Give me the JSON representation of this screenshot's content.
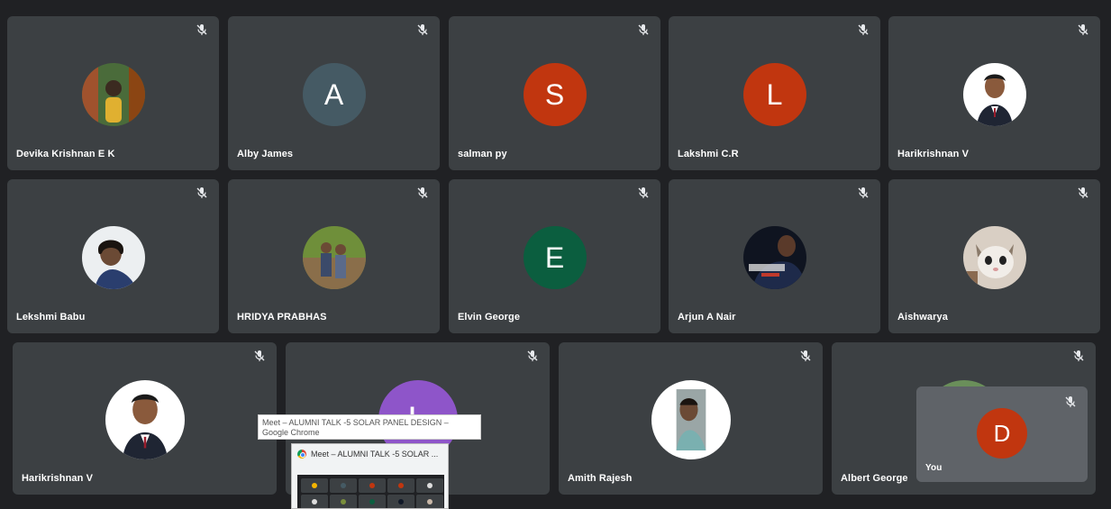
{
  "participants": [
    {
      "name": "Devika Krishnan E K",
      "initial": "",
      "avatar": "photo",
      "color": "#6b8e4e"
    },
    {
      "name": "Alby James",
      "initial": "A",
      "avatar": "letter",
      "color": "#455a64"
    },
    {
      "name": "salman py",
      "initial": "S",
      "avatar": "letter",
      "color": "#c1360f"
    },
    {
      "name": "Lakshmi C.R",
      "initial": "L",
      "avatar": "letter",
      "color": "#c1360f"
    },
    {
      "name": "Harikrishnan V",
      "initial": "",
      "avatar": "photo",
      "color": "#ffffff"
    },
    {
      "name": "Lekshmi Babu",
      "initial": "",
      "avatar": "photo",
      "color": "#e8e8e8"
    },
    {
      "name": "HRIDYA PRABHAS",
      "initial": "",
      "avatar": "photo",
      "color": "#7a8f3c"
    },
    {
      "name": "Elvin George",
      "initial": "E",
      "avatar": "letter",
      "color": "#0b5e3f"
    },
    {
      "name": "Arjun A Nair",
      "initial": "",
      "avatar": "photo",
      "color": "#101827"
    },
    {
      "name": "Aishwarya",
      "initial": "",
      "avatar": "photo",
      "color": "#c9b8a8"
    },
    {
      "name": "Harikrishnan V",
      "initial": "",
      "avatar": "photo",
      "color": "#ffffff"
    },
    {
      "name": "",
      "initial": "L",
      "avatar": "letter",
      "color": "#8e55c9"
    },
    {
      "name": "Amith Rajesh",
      "initial": "",
      "avatar": "photo",
      "color": "#ffffff"
    },
    {
      "name": "Albert George",
      "initial": "",
      "avatar": "photo",
      "color": "#6a8f5a"
    }
  ],
  "self_view": {
    "name": "You",
    "initial": "D",
    "color": "#c1360f"
  },
  "tooltip": {
    "text": "Meet – ALUMNI TALK -5 SOLAR PANEL DESIGN – Google Chrome"
  },
  "preview": {
    "title": "Meet – ALUMNI TALK -5 SOLAR ..."
  }
}
